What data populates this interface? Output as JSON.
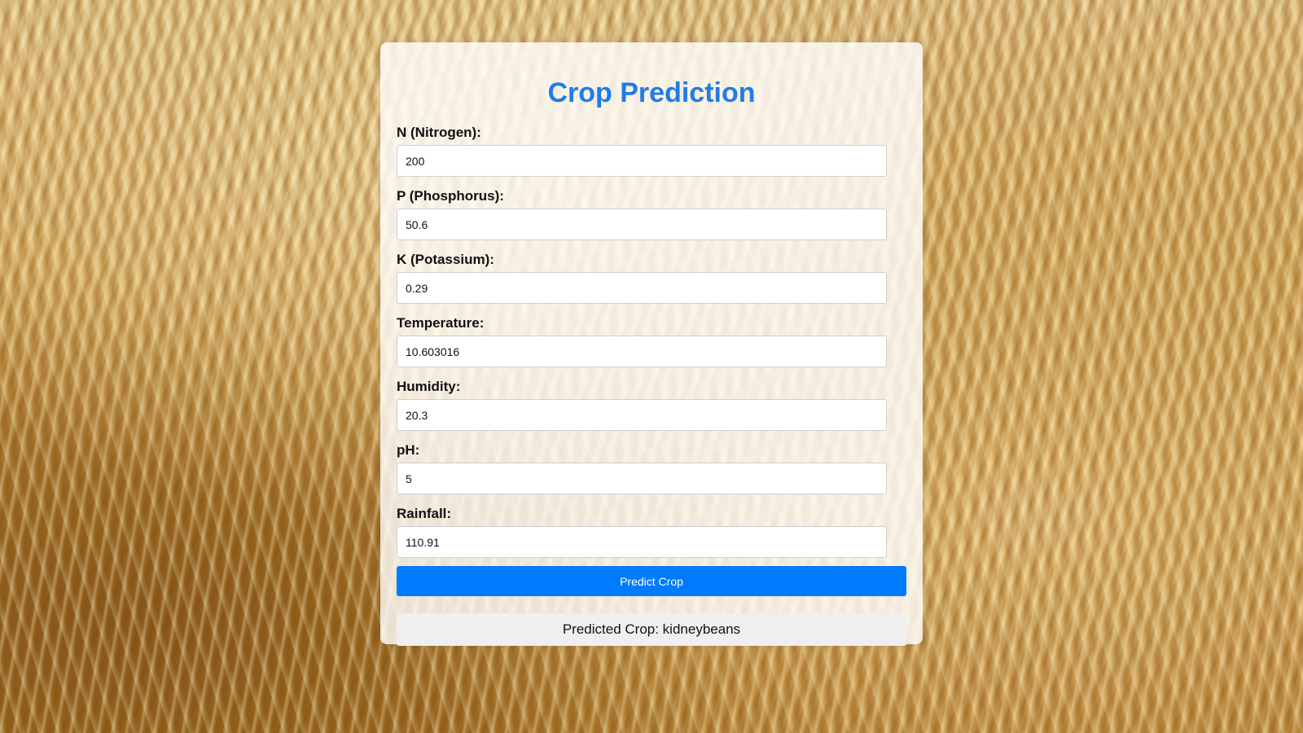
{
  "page": {
    "title": "Crop Prediction"
  },
  "form": {
    "fields": [
      {
        "label": "N (Nitrogen):",
        "value": "200"
      },
      {
        "label": "P (Phosphorus):",
        "value": "50.6"
      },
      {
        "label": "K (Potassium):",
        "value": "0.29"
      },
      {
        "label": "Temperature:",
        "value": "10.603016"
      },
      {
        "label": "Humidity:",
        "value": "20.3"
      },
      {
        "label": "pH:",
        "value": "5"
      },
      {
        "label": "Rainfall:",
        "value": "110.91"
      }
    ],
    "submit_label": "Predict Crop"
  },
  "result": {
    "text": "Predicted Crop: kidneybeans"
  },
  "colors": {
    "accent": "#007bff",
    "title": "#1f7ce8",
    "result_bg": "#efefef"
  }
}
